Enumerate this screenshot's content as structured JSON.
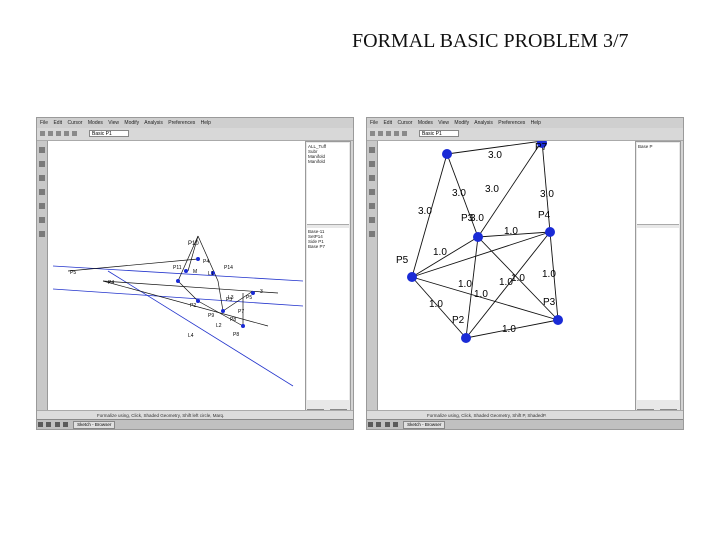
{
  "slide": {
    "title": "FORMAL BASIC PROBLEM 3/7"
  },
  "left_app": {
    "menu": [
      "File",
      "Edit",
      "Cursor",
      "Modes",
      "View",
      "Modify",
      "Analysis",
      "Preferences",
      "Help"
    ],
    "tool_select": "Basic P1",
    "tree_items": [
      "ALL_Tuff",
      "Subr",
      "Manifold",
      "Manifold"
    ],
    "list_items": [
      "Base-11",
      "SetP14",
      "Side P1",
      "Base P7"
    ],
    "buttons": [
      "Ignore",
      "Delete"
    ],
    "status": "Formalize using, Click, Shaded Geometry, Shift left circle, Marq.",
    "task_btn": "Sketch - Browser",
    "geometry": {
      "labels": [
        "P10",
        "P11",
        "P14",
        "P4",
        "P2",
        "P9",
        "P5",
        "P8",
        "P4",
        "P5",
        "P8",
        "P3",
        "P7",
        "L4",
        "L1",
        "L2",
        "L3",
        "M",
        "3"
      ]
    }
  },
  "right_app": {
    "menu": [
      "File",
      "Edit",
      "Cursor",
      "Modes",
      "View",
      "Modify",
      "Analysis",
      "Preferences",
      "Help"
    ],
    "tool_select": "Basic P1",
    "tree_items": [
      "Base P"
    ],
    "buttons": [
      "Ignore",
      "Delete"
    ],
    "status": "Formalize using, Click, Shaded Geometry, Shift P, ShadedP.",
    "task_btn": "Sketch - Browser",
    "points": [
      "P7",
      "P4",
      "P3",
      "P2",
      "P5",
      "P3"
    ],
    "weights": [
      "3.0",
      "3.0",
      "3.0",
      "3.0",
      "3.0",
      "3.0",
      "1.0",
      "1.0",
      "1.0",
      "1.0",
      "1.0",
      "1.0",
      "1.0",
      "1.0",
      "1.0",
      "1.0"
    ]
  }
}
